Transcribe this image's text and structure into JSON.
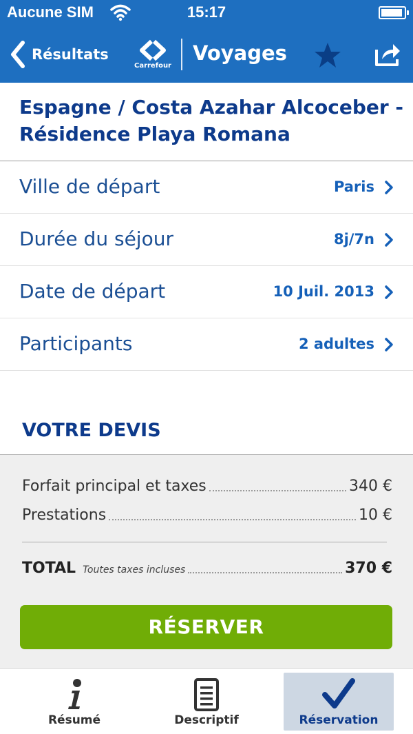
{
  "status_bar": {
    "carrier": "Aucune SIM",
    "time": "15:17",
    "battery_level": 0.95
  },
  "nav": {
    "back_label": "Résultats",
    "logo_text": "Carrefour",
    "title": "Voyages"
  },
  "offer": {
    "title": "Espagne / Costa Azahar Alcoceber - Résidence Playa Romana"
  },
  "options": [
    {
      "label": "Ville de départ",
      "value": "Paris"
    },
    {
      "label": "Durée du séjour",
      "value": "8j/7n"
    },
    {
      "label": "Date de départ",
      "value": "10 Juil. 2013"
    },
    {
      "label": "Participants",
      "value": "2 adultes"
    }
  ],
  "quote": {
    "title": "VOTRE DEVIS",
    "lines": [
      {
        "label": "Forfait principal et taxes",
        "amount": "340 €"
      },
      {
        "label": "Prestations",
        "amount": "10 €"
      }
    ],
    "total": {
      "label": "TOTAL",
      "note": "Toutes taxes incluses",
      "amount": "370 €"
    },
    "reserve_label": "RÉSERVER"
  },
  "tabs": [
    {
      "label": "Résumé",
      "icon": "info-icon"
    },
    {
      "label": "Descriptif",
      "icon": "document-icon"
    },
    {
      "label": "Réservation",
      "icon": "checkmark-icon",
      "active": true
    }
  ],
  "colors": {
    "brand_blue": "#1e6fc0",
    "title_navy": "#0d3a8b",
    "value_blue": "#1560b8",
    "reserve_green": "#70ad06",
    "active_tab_bg": "#cdd7e3"
  }
}
